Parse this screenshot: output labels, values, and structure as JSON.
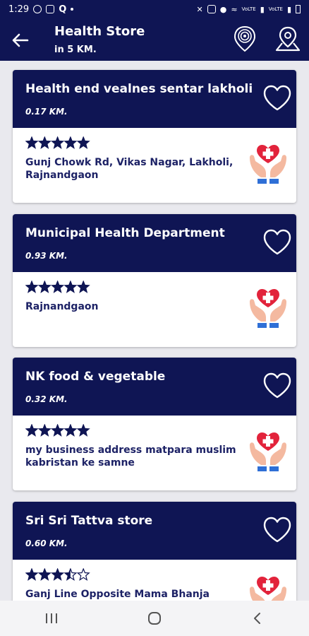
{
  "status": {
    "time": "1:29",
    "net1": "VoLTE",
    "net2": "VoLTE"
  },
  "header": {
    "title": "Health Store",
    "subtitle": "in 5 KM."
  },
  "stores": [
    {
      "name": "Health end vealnes sentar lakholi",
      "distance": "0.17 KM.",
      "rating": 5,
      "address": "Gunj Chowk Rd, Vikas Nagar, Lakholi, Rajnandgaon"
    },
    {
      "name": "Municipal Health Department",
      "distance": "0.93 KM.",
      "rating": 5,
      "address": "Rajnandgaon"
    },
    {
      "name": "NK food & vegetable",
      "distance": "0.32 KM.",
      "rating": 5,
      "address": "my business address matpara muslim kabristan ke samne"
    },
    {
      "name": "Sri Sri Tattva store",
      "distance": "0.60 KM.",
      "rating": 3.5,
      "address": "Ganj Line Opposite Mama Bhanja Majar,"
    }
  ],
  "colors": {
    "primary": "#0f1554",
    "heart": "#e2233b",
    "hands": "#f4b9a0",
    "cuff": "#2f6fd6"
  },
  "icons": [
    "back-arrow-icon",
    "radar-icon",
    "map-pin-icon",
    "heart-outline-icon",
    "health-care-hands-icon",
    "star-icon",
    "recent-apps-icon",
    "home-icon",
    "back-nav-icon"
  ]
}
